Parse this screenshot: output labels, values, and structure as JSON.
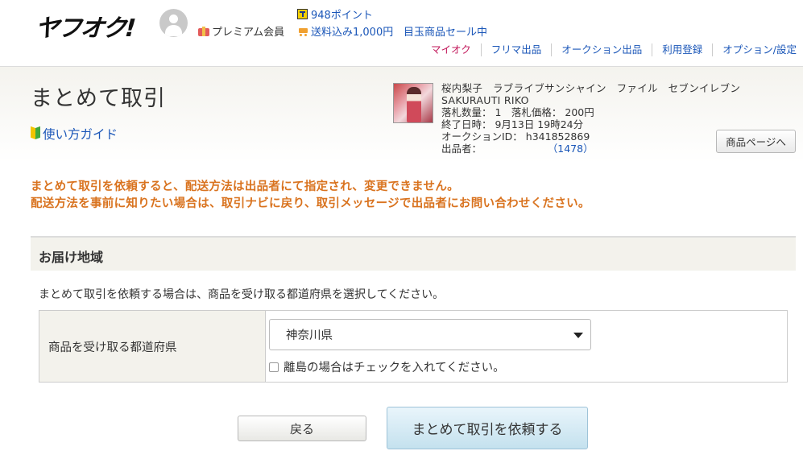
{
  "header": {
    "logo_text": "ヤフオク!",
    "premium_label": "プレミアム会員",
    "points_label": "948ポイント",
    "shipping_label": "送料込み1,000円",
    "sale_label": "目玉商品セール中"
  },
  "topnav": {
    "items": [
      "マイオク",
      "フリマ出品",
      "オークション出品",
      "利用登録",
      "オプション/設定"
    ]
  },
  "page": {
    "title": "まとめて取引",
    "guide_label": "使い方ガイド"
  },
  "item": {
    "name": "桜内梨子　ラブライブサンシャイン　ファイル　セブンイレブン　SAKURAUTI RIKO",
    "winning_line": "落札数量： 1　落札価格： 200円",
    "end_line": "終了日時： 9月13日 19時24分",
    "auction_line": "オークションID： h341852869",
    "seller_label": "出品者：",
    "seller_rating": "（1478）",
    "product_page_button": "商品ページへ"
  },
  "notice": {
    "line1": "まとめて取引を依頼すると、配送方法は出品者にて指定され、変更できません。",
    "line2": "配送方法を事前に知りたい場合は、取引ナビに戻り、取引メッセージで出品者にお問い合わせください。"
  },
  "delivery": {
    "section_title": "お届け地域",
    "instruction": "まとめて取引を依頼する場合は、商品を受け取る都道府県を選択してください。",
    "field_label": "商品を受け取る都道府県",
    "selected_prefecture": "神奈川県",
    "island_checkbox_label": "離島の場合はチェックを入れてください。",
    "island_checked": false
  },
  "actions": {
    "back_label": "戻る",
    "request_label": "まとめて取引を依頼する"
  },
  "colors": {
    "notice": "#d9731f",
    "link": "#1a56b8",
    "mypage_link": "#c2185b",
    "section_bg": "#f3f2ec"
  }
}
